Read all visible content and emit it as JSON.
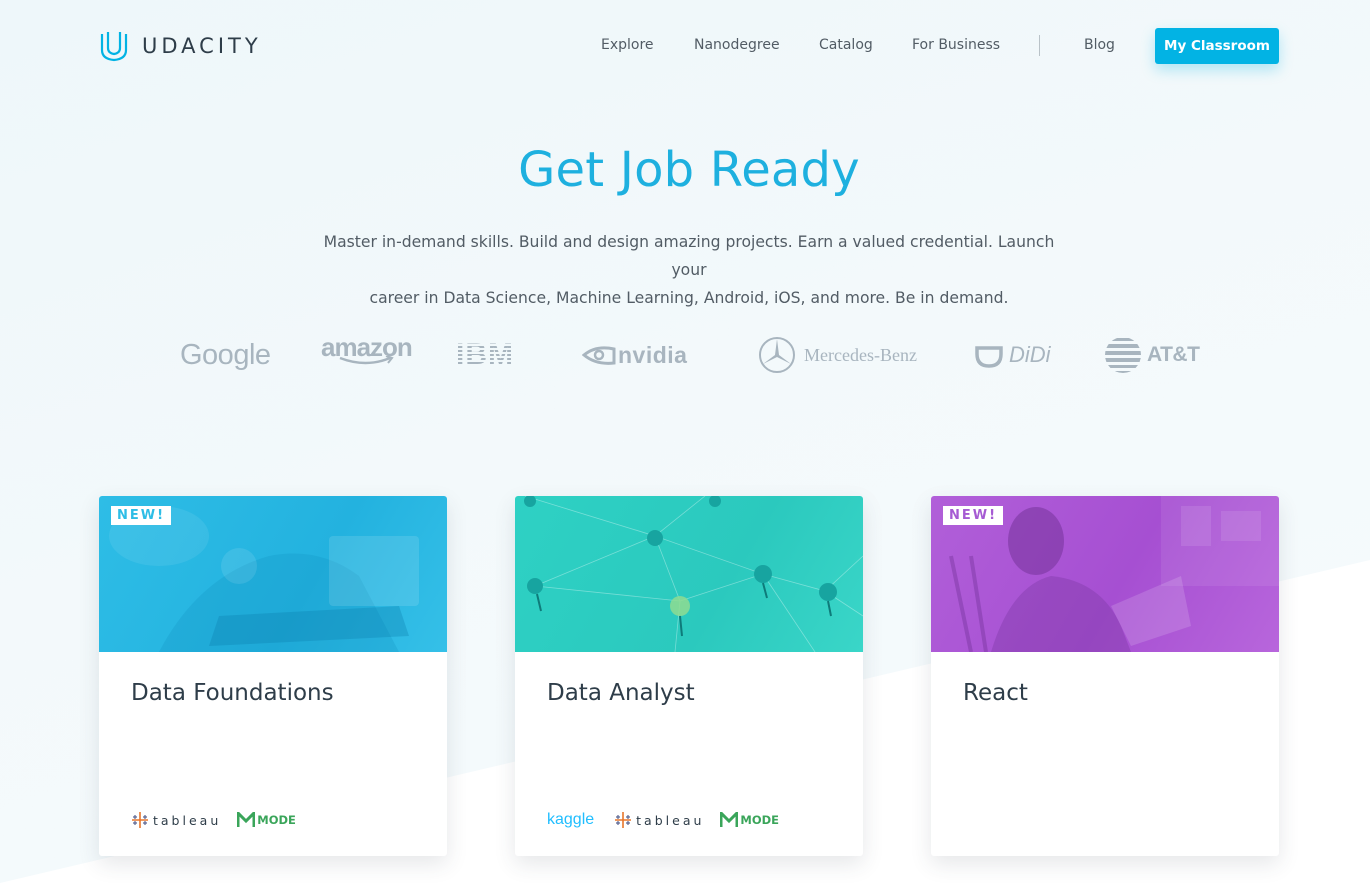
{
  "brand": {
    "name": "UDACITY",
    "logo_icon": "udacity-u-logo",
    "accent": "#02b3e4"
  },
  "nav": {
    "links": [
      "Explore",
      "Nanodegree",
      "Catalog",
      "For Business",
      "Blog"
    ],
    "cta_label": "My Classroom"
  },
  "hero": {
    "title": "Get Job Ready",
    "subtitle_line1": "Master in-demand skills. Build and design amazing projects. Earn a valued credential. Launch your",
    "subtitle_line2": "career in Data Science, Machine Learning, Android, iOS, and more. Be in demand."
  },
  "partners": [
    "Google",
    "amazon",
    "IBM",
    "nvidia",
    "Mercedes-Benz",
    "DiDi",
    "AT&T"
  ],
  "cards": [
    {
      "title": "Data Foundations",
      "badge": "NEW!",
      "color": "#2ebde6",
      "tools": [
        "tableau",
        "MODE"
      ]
    },
    {
      "title": "Data Analyst",
      "badge": "",
      "color": "#2ed1c4",
      "tools": [
        "kaggle",
        "tableau",
        "MODE"
      ]
    },
    {
      "title": "React",
      "badge": "NEW!",
      "color": "#b15fd9",
      "tools": []
    }
  ]
}
